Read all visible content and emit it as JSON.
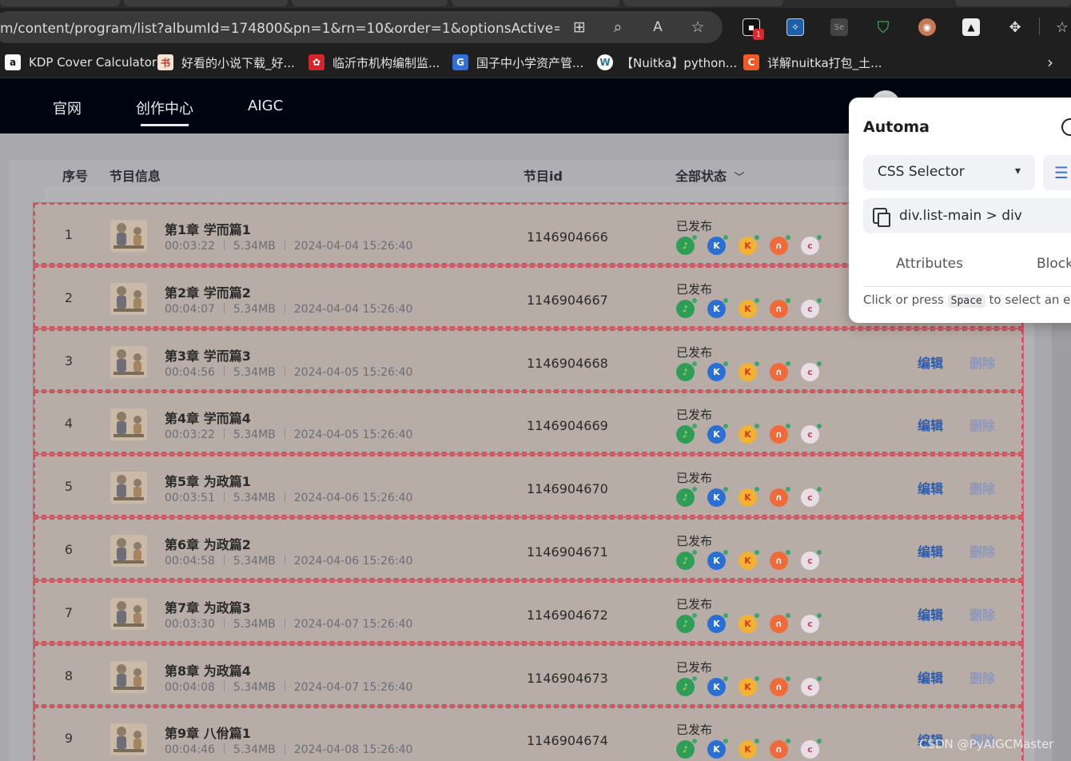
{
  "browser": {
    "url": "m/content/program/list?albumId=174800&pn=1&rn=10&order=1&optionsActive=all&s...",
    "ext_badge": "1",
    "bookmarks": [
      {
        "label": "KDP Cover Calculator",
        "icon": "amazon-icon",
        "color": "#222222",
        "glyph": "a"
      },
      {
        "label": "好看的小说下载_好...",
        "icon": "novel-site-icon",
        "color": "#c0392b",
        "glyph": "书"
      },
      {
        "label": "临沂市机构编制监...",
        "icon": "gov-seal-icon",
        "color": "#d4252b",
        "glyph": "✿"
      },
      {
        "label": "国子中小学资产管...",
        "icon": "g-icon",
        "color": "#2f6fd6",
        "glyph": "G"
      },
      {
        "label": "【Nuitka】python...",
        "icon": "wordpress-icon",
        "color": "#ffffff",
        "glyph": "W"
      },
      {
        "label": "详解nuitka打包_土...",
        "icon": "csdn-icon",
        "color": "#f05a28",
        "glyph": "C"
      }
    ]
  },
  "nav": {
    "items": [
      "官网",
      "创作中心",
      "AIGC"
    ],
    "active": "创作中心"
  },
  "table": {
    "headers": {
      "index": "序号",
      "info": "节目信息",
      "id": "节目id",
      "status": "全部状态"
    },
    "edit_label": "编辑",
    "delete_label": "删除",
    "rows": [
      {
        "index": "1",
        "title": "第1章 学而篇1",
        "duration": "00:03:22",
        "size": "5.34MB",
        "date": "2024-04-04 15:26:40",
        "id": "1146904666",
        "status": "已发布"
      },
      {
        "index": "2",
        "title": "第2章 学而篇2",
        "duration": "00:04:07",
        "size": "5.34MB",
        "date": "2024-04-04 15:26:40",
        "id": "1146904667",
        "status": "已发布"
      },
      {
        "index": "3",
        "title": "第3章 学而篇3",
        "duration": "00:04:56",
        "size": "5.34MB",
        "date": "2024-04-05 15:26:40",
        "id": "1146904668",
        "status": "已发布"
      },
      {
        "index": "4",
        "title": "第4章 学而篇4",
        "duration": "00:03:22",
        "size": "5.34MB",
        "date": "2024-04-05 15:26:40",
        "id": "1146904669",
        "status": "已发布"
      },
      {
        "index": "5",
        "title": "第5章 为政篇1",
        "duration": "00:03:51",
        "size": "5.34MB",
        "date": "2024-04-06 15:26:40",
        "id": "1146904670",
        "status": "已发布"
      },
      {
        "index": "6",
        "title": "第6章 为政篇2",
        "duration": "00:04:58",
        "size": "5.34MB",
        "date": "2024-04-06 15:26:40",
        "id": "1146904671",
        "status": "已发布"
      },
      {
        "index": "7",
        "title": "第7章 为政篇3",
        "duration": "00:03:30",
        "size": "5.34MB",
        "date": "2024-04-07 15:26:40",
        "id": "1146904672",
        "status": "已发布"
      },
      {
        "index": "8",
        "title": "第8章 为政篇4",
        "duration": "00:04:08",
        "size": "5.34MB",
        "date": "2024-04-07 15:26:40",
        "id": "1146904673",
        "status": "已发布"
      },
      {
        "index": "9",
        "title": "第9章 八佾篇1",
        "duration": "00:04:46",
        "size": "5.34MB",
        "date": "2024-04-08 15:26:40",
        "id": "1146904674",
        "status": "已发布"
      }
    ],
    "platforms": [
      {
        "icon": "qq-music-icon",
        "bg": "#2e9e57",
        "fg": "#f5d33a",
        "glyph": "♪"
      },
      {
        "icon": "kugou-icon",
        "bg": "#2a6fd6",
        "fg": "#ffffff",
        "glyph": "K"
      },
      {
        "icon": "kuwo-icon",
        "bg": "#f2b233",
        "fg": "#d43b1f",
        "glyph": "K"
      },
      {
        "icon": "ximalaya-icon",
        "bg": "#f06a3a",
        "fg": "#ffffff",
        "glyph": "∩"
      },
      {
        "icon": "cool-icon",
        "bg": "#e9dde6",
        "fg": "#d1405a",
        "glyph": "c"
      }
    ]
  },
  "automa": {
    "title": "Automa",
    "selector_type": "CSS Selector",
    "selector_path": "div.list-main > div",
    "tab_attributes": "Attributes",
    "tab_blocks": "Block",
    "hint_prefix": "Click or press",
    "hint_key": "Space",
    "hint_suffix": "to select an e"
  },
  "watermark": "CSDN @PyAIGCMaster"
}
